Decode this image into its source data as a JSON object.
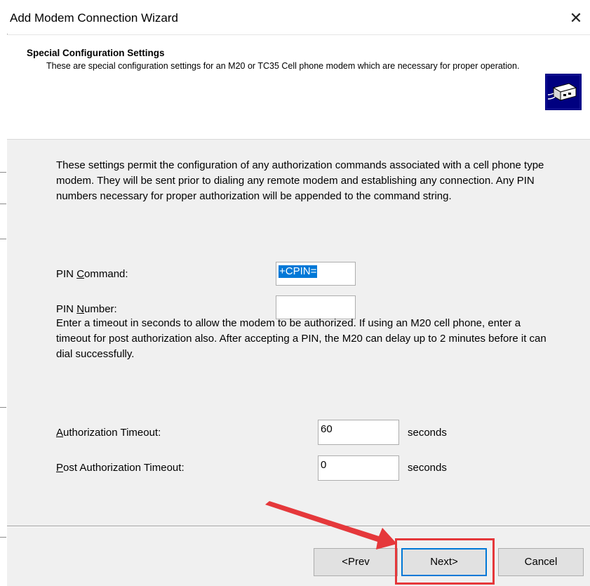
{
  "window": {
    "title": "Add Modem Connection Wizard",
    "close_glyph": "✕"
  },
  "header": {
    "title": "Special Configuration Settings",
    "subtitle": "These are special configuration settings for an M20 or TC35 Cell phone modem which are necessary for proper operation.",
    "icon": "modem-wizard-icon"
  },
  "main": {
    "intro": "These settings permit the configuration of any authorization commands associated with a cell phone type modem.  They will be sent prior to dialing any remote modem and establishing any connection.  Any PIN numbers necessary for proper authorization will be appended to the command string.",
    "pin_command": {
      "label_pre": "PIN ",
      "label_mnemonic": "C",
      "label_post": "ommand:",
      "value": "+CPIN="
    },
    "pin_number": {
      "label_pre": "PIN ",
      "label_mnemonic": "N",
      "label_post": "umber:",
      "value": ""
    },
    "timeout_info": "Enter a timeout in seconds to allow the modem to be authorized.  If using an M20 cell phone, enter a timeout for post authorization also.  After accepting a PIN, the M20 can delay up to 2 minutes before it can dial successfully.",
    "auth_timeout": {
      "label_mnemonic": "A",
      "label_post": "uthorization Timeout:",
      "value": "60",
      "unit": "seconds"
    },
    "post_auth_timeout": {
      "label_mnemonic": "P",
      "label_post": "ost Authorization Timeout:",
      "value": "0",
      "unit": "seconds"
    }
  },
  "buttons": {
    "prev": "<Prev",
    "next": "Next>",
    "cancel": "Cancel"
  },
  "colors": {
    "annotation": "#e5383b",
    "selection": "#0078d7"
  }
}
